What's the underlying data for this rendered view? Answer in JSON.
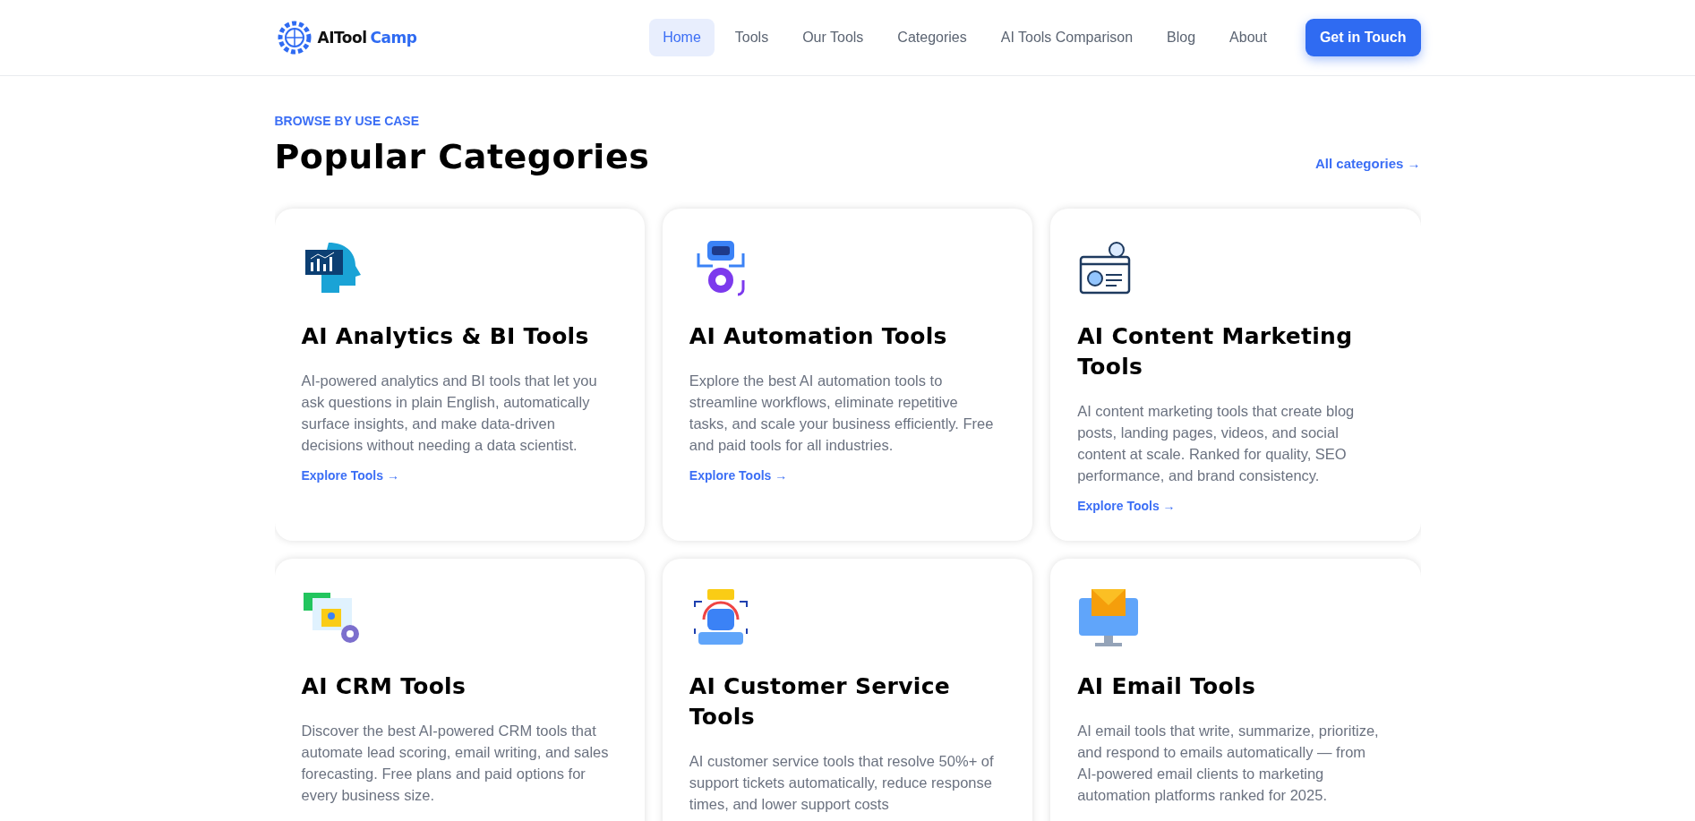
{
  "header": {
    "logo": {
      "part_1": "AITool",
      "part_2": "Camp"
    },
    "nav": [
      {
        "label": "Home",
        "selected": true
      },
      {
        "label": "Tools",
        "selected": false
      },
      {
        "label": "Our Tools",
        "selected": false
      },
      {
        "label": "Categories",
        "selected": false
      },
      {
        "label": "AI Tools Comparison",
        "selected": false
      },
      {
        "label": "Blog",
        "selected": false
      },
      {
        "label": "About",
        "selected": false
      }
    ],
    "cta": "Get in Touch"
  },
  "section": {
    "eyebrow": "BROWSE BY USE CASE",
    "title": "Popular Categories",
    "all_link": "All categories →"
  },
  "categories": [
    {
      "kind": "analytics",
      "title": "AI Analytics & BI Tools",
      "description": "AI-powered analytics and BI tools that let you ask questions in plain English, automatically surface insights, and make data-driven decisions without needing a data scientist.",
      "link": "Explore Tools →"
    },
    {
      "kind": "robot",
      "title": "AI Automation Tools",
      "description": "Explore the best AI automation tools to streamline workflows, eliminate repetitive tasks, and scale your business efficiently. Free and paid tools for all industries.",
      "link": "Explore Tools →"
    },
    {
      "kind": "content",
      "title": "AI Content Marketing Tools",
      "description": "AI content marketing tools that create blog posts, landing pages, videos, and social content at scale. Ranked for quality, SEO performance, and brand consistency.",
      "link": "Explore Tools →"
    },
    {
      "kind": "crm",
      "title": "AI CRM Tools",
      "description": "Discover the best AI-powered CRM tools that automate lead scoring, email writing, and sales forecasting. Free plans and paid options for every business size."
    },
    {
      "kind": "support",
      "title": "AI Customer Service Tools",
      "description": "AI customer service tools that resolve 50%+ of support tickets automatically, reduce response times, and lower support costs"
    },
    {
      "kind": "email",
      "title": "AI Email Tools",
      "description": "AI email tools that write, summarize, prioritize, and respond to emails automatically — from AI-powered email clients to marketing automation platforms ranked for 2025."
    }
  ]
}
